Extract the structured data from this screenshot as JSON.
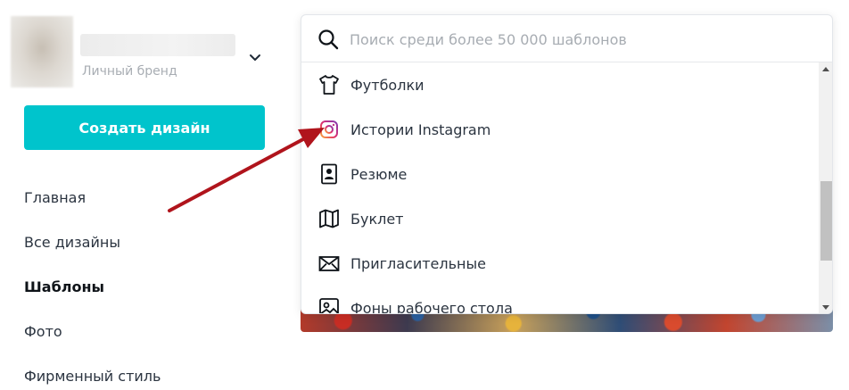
{
  "account": {
    "subtitle": "Личный бренд",
    "chevron_icon": "chevron-down-icon"
  },
  "sidebar": {
    "create_button": "Создать дизайн",
    "create_button_color": "#00c4cc",
    "items": [
      {
        "label": "Главная",
        "active": false
      },
      {
        "label": "Все дизайны",
        "active": false
      },
      {
        "label": "Шаблоны",
        "active": true
      },
      {
        "label": "Фото",
        "active": false
      },
      {
        "label": "Фирменный стиль",
        "active": false
      }
    ]
  },
  "search": {
    "placeholder": "Поиск среди более 50 000 шаблонов",
    "value": "",
    "icon": "search-icon"
  },
  "dropdown": {
    "items": [
      {
        "label": "Футболки",
        "icon": "tshirt-icon"
      },
      {
        "label": "Истории Instagram",
        "icon": "instagram-icon"
      },
      {
        "label": "Резюме",
        "icon": "resume-icon"
      },
      {
        "label": "Буклет",
        "icon": "map-booklet-icon"
      },
      {
        "label": "Пригласительные",
        "icon": "envelope-icon"
      },
      {
        "label": "Фоны рабочего стола",
        "icon": "image-icon"
      }
    ]
  },
  "annotation": {
    "arrow_color": "#b0141c",
    "points_to": "Истории Instagram"
  }
}
